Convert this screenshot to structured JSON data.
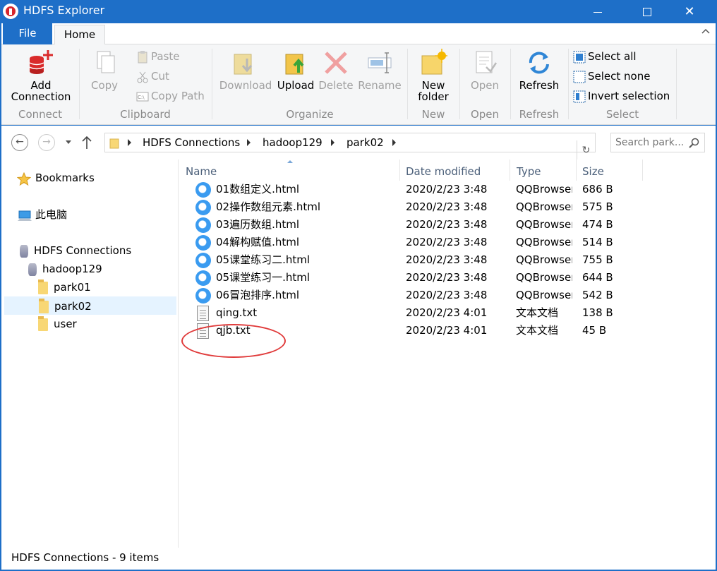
{
  "window": {
    "title": "HDFS Explorer",
    "brand_color": "#1e6fc8",
    "controls": [
      "minimize-icon",
      "maximize-icon",
      "close-icon"
    ]
  },
  "ribbon": {
    "tabs": {
      "file": "File",
      "home": "Home"
    },
    "groups": {
      "connect": {
        "label": "Connect",
        "add_connection": "Add Connection"
      },
      "clipboard": {
        "label": "Clipboard",
        "copy": "Copy",
        "paste": "Paste",
        "cut": "Cut",
        "copy_path": "Copy Path"
      },
      "organize": {
        "label": "Organize",
        "download": "Download",
        "upload": "Upload",
        "delete": "Delete",
        "rename": "Rename"
      },
      "new": {
        "label": "New",
        "new_folder": "New folder"
      },
      "open": {
        "label": "Open",
        "open": "Open"
      },
      "refresh": {
        "label": "Refresh",
        "refresh": "Refresh"
      },
      "select": {
        "label": "Select",
        "select_all": "Select all",
        "select_none": "Select none",
        "invert_selection": "Invert selection"
      }
    }
  },
  "address": {
    "crumbs": [
      "HDFS Connections",
      "hadoop129",
      "park02"
    ],
    "search_placeholder": "Search park..."
  },
  "tree": {
    "bookmarks": "Bookmarks",
    "this_pc": "此电脑",
    "hdfs_connections": "HDFS Connections",
    "host": "hadoop129",
    "folders": [
      "park01",
      "park02",
      "user"
    ],
    "selected": "park02"
  },
  "list": {
    "columns": {
      "name": "Name",
      "date": "Date modified",
      "type": "Type",
      "size": "Size"
    },
    "rows": [
      {
        "name": "01数组定义.html",
        "date": "2020/2/23 3:48",
        "type": "QQBrowser",
        "size": "686 B",
        "icon": "qqbrowser-html-icon"
      },
      {
        "name": "02操作数组元素.html",
        "date": "2020/2/23 3:48",
        "type": "QQBrowser",
        "size": "575 B",
        "icon": "qqbrowser-html-icon"
      },
      {
        "name": "03遍历数组.html",
        "date": "2020/2/23 3:48",
        "type": "QQBrowser",
        "size": "474 B",
        "icon": "qqbrowser-html-icon"
      },
      {
        "name": "04解构赋值.html",
        "date": "2020/2/23 3:48",
        "type": "QQBrowser",
        "size": "514 B",
        "icon": "qqbrowser-html-icon"
      },
      {
        "name": "05课堂练习二.html",
        "date": "2020/2/23 3:48",
        "type": "QQBrowser",
        "size": "755 B",
        "icon": "qqbrowser-html-icon"
      },
      {
        "name": "05课堂练习一.html",
        "date": "2020/2/23 3:48",
        "type": "QQBrowser",
        "size": "644 B",
        "icon": "qqbrowser-html-icon"
      },
      {
        "name": "06冒泡排序.html",
        "date": "2020/2/23 3:48",
        "type": "QQBrowser",
        "size": "542 B",
        "icon": "qqbrowser-html-icon"
      },
      {
        "name": "qing.txt",
        "date": "2020/2/23 4:01",
        "type": "文本文档",
        "size": "138 B",
        "icon": "text-file-icon"
      },
      {
        "name": "qjb.txt",
        "date": "2020/2/23 4:01",
        "type": "文本文档",
        "size": "45 B",
        "icon": "text-file-icon"
      }
    ]
  },
  "status": {
    "text": "HDFS Connections - 9 items"
  },
  "annotation_color": "#e03a3a"
}
